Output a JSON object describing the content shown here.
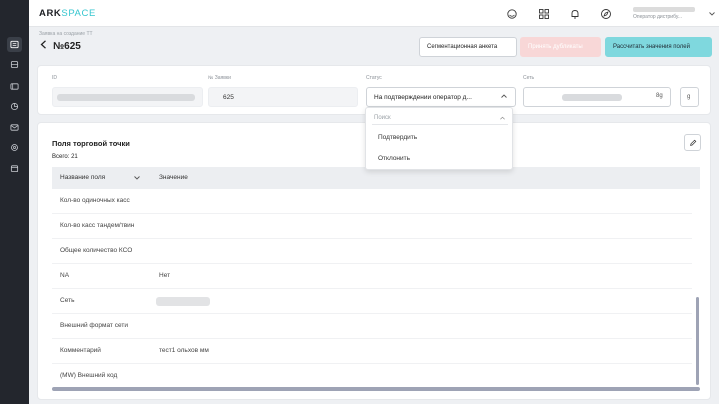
{
  "logo": {
    "main": "ARK",
    "accent": "SPACE"
  },
  "topbar": {
    "icons": [
      "headset-icon",
      "grid-icon",
      "bell-icon",
      "compass-icon"
    ],
    "user_role": "Оператор дистрибу..."
  },
  "sidebar": {
    "items": [
      "list-icon",
      "database-icon",
      "folder-icon",
      "chart-icon",
      "mail-icon",
      "settings-icon",
      "calendar-icon"
    ],
    "active_index": 0
  },
  "header": {
    "breadcrumb": "Заявка на создание ТТ",
    "title": "№625",
    "buttons": {
      "segmentation": "Сегментационная анкета",
      "disabled": "Принять дубликаты",
      "calculate": "Рассчитать значения полей"
    }
  },
  "fields": {
    "id_label": "ID",
    "request_label": "№ Заявки",
    "request_value": "625",
    "status_label": "Статус",
    "status_value": "На подтверждении оператор д...",
    "network_label": "Сеть",
    "network_suffix": "8g",
    "extra_button": "g"
  },
  "dropdown": {
    "search_placeholder": "Поиск",
    "options": [
      "Подтвердить",
      "Отклонить"
    ]
  },
  "section": {
    "title": "Поля торговой точки",
    "total": "Всего: 21",
    "columns": [
      "Название поля",
      "Значение"
    ],
    "rows": [
      {
        "name": "Кол-во одиночных касс",
        "value": ""
      },
      {
        "name": "Кол-во касс тандем/твин",
        "value": ""
      },
      {
        "name": "Общее количество КСО",
        "value": ""
      },
      {
        "name": "NA",
        "value": "Нет"
      },
      {
        "name": "Сеть",
        "value": ""
      },
      {
        "name": "Внешний формат сети",
        "value": ""
      },
      {
        "name": "Комментарий",
        "value": "тест1 ольхов мм"
      },
      {
        "name": "(MW) Внешний код",
        "value": ""
      }
    ]
  },
  "colors": {
    "accent": "#7fd8de",
    "disabled_button": "#f8d7d7",
    "sidebar": "#23262d"
  }
}
